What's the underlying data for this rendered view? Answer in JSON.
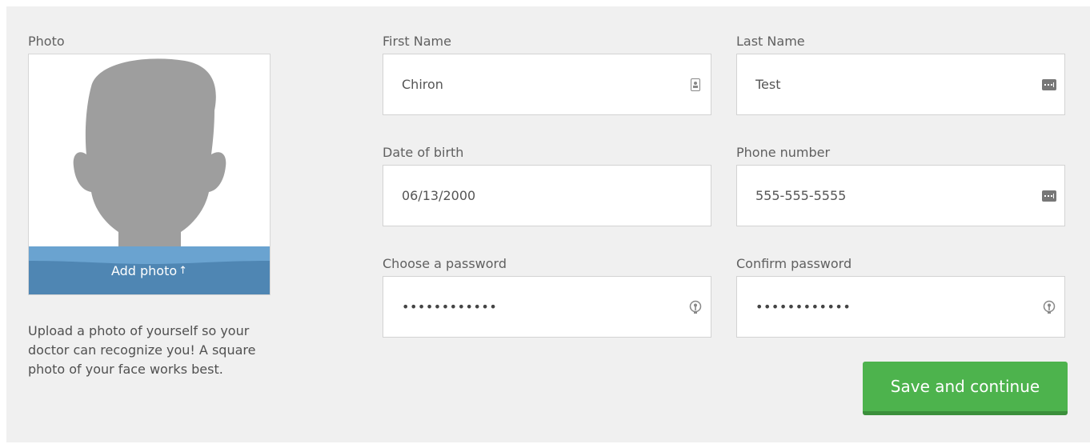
{
  "photo": {
    "label": "Photo",
    "add_photo_label": "Add photo",
    "add_photo_icon": "upload-arrow-icon",
    "help_text": "Upload a photo of yourself so your doctor can recognize you! A square photo of your face works best."
  },
  "form": {
    "first_name": {
      "label": "First Name",
      "value": "Chiron",
      "icon": "contact-card-icon"
    },
    "last_name": {
      "label": "Last Name",
      "value": "Test",
      "icon": "keyboard-autofill-icon"
    },
    "date_of_birth": {
      "label": "Date of birth",
      "value": "06/13/2000"
    },
    "phone": {
      "label": "Phone number",
      "value": "555-555-5555",
      "icon": "keyboard-autofill-icon"
    },
    "password": {
      "label": "Choose a password",
      "value": "••••••••••••",
      "icon": "key-icon"
    },
    "confirm_password": {
      "label": "Confirm password",
      "value": "••••••••••••",
      "icon": "key-icon"
    }
  },
  "actions": {
    "save_label": "Save and continue"
  },
  "colors": {
    "panel_bg": "#f0f0f0",
    "accent_green": "#4db34d",
    "photo_band": "#5a95c4"
  }
}
